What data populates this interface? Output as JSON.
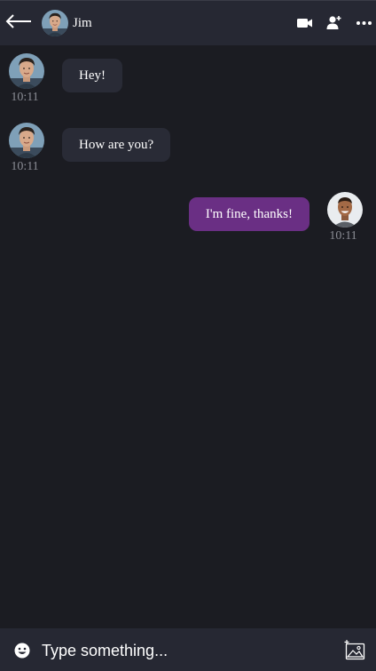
{
  "header": {
    "contact_name": "Jim",
    "icons": [
      "back-arrow-icon",
      "video-camera-icon",
      "add-user-icon",
      "more-options-icon"
    ]
  },
  "messages": [
    {
      "direction": "incoming",
      "text": "Hey!",
      "time": "10:11"
    },
    {
      "direction": "incoming",
      "text": "How are you?",
      "time": "10:11"
    },
    {
      "direction": "outgoing",
      "text": "I'm fine, thanks!",
      "time": "10:11"
    }
  ],
  "composer": {
    "placeholder": "Type something...",
    "value": "",
    "icons": [
      "emoji-icon",
      "add-image-icon"
    ]
  },
  "colors": {
    "background": "#1b1c22",
    "header": "#262833",
    "incoming_bubble": "#292b36",
    "outgoing_bubble": "#6a2f84",
    "timestamp": "#8a8c94"
  }
}
